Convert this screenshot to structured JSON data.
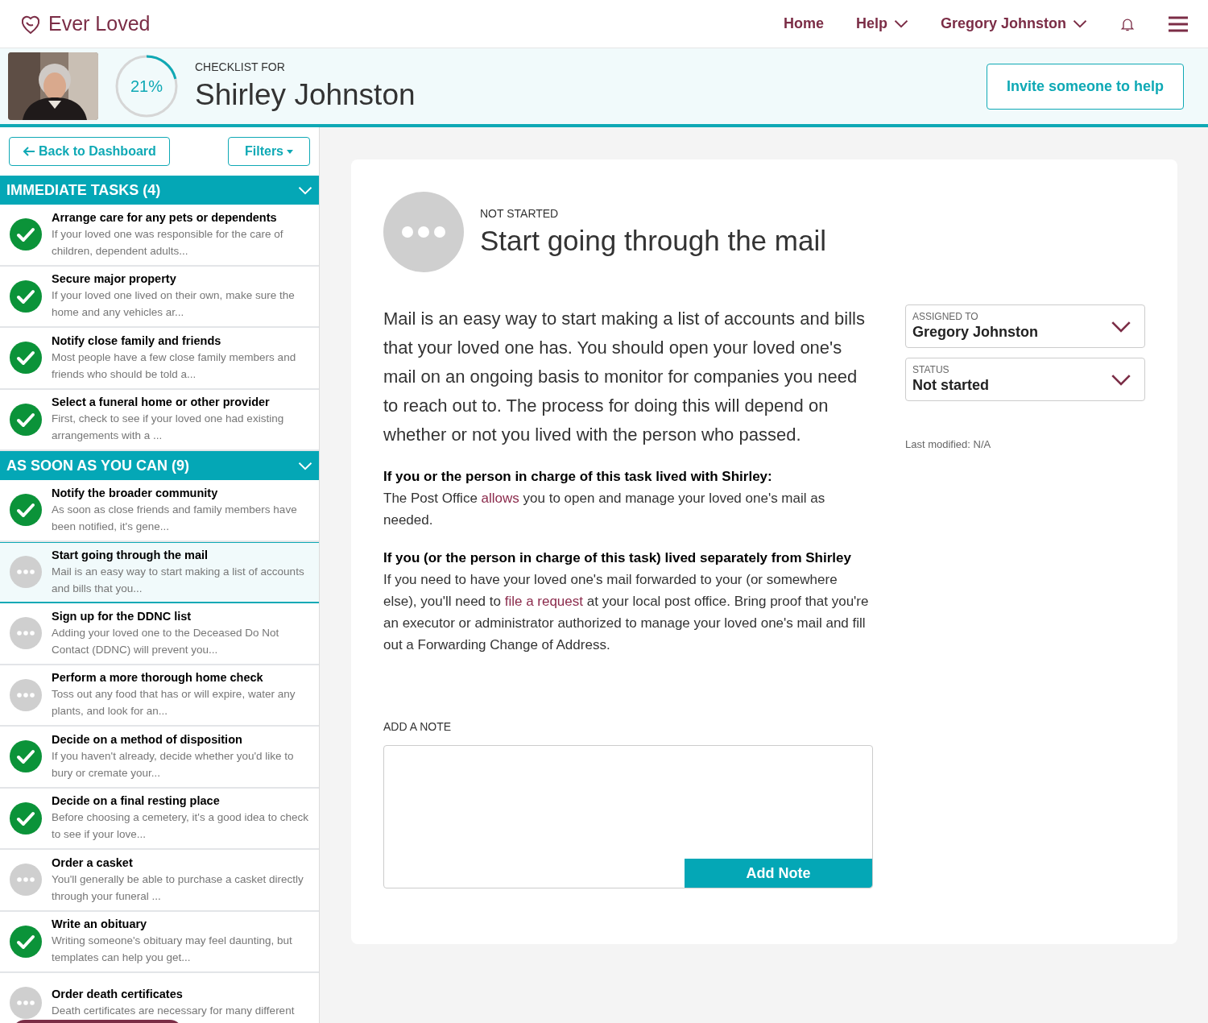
{
  "brand": {
    "name": "Ever Loved"
  },
  "nav": {
    "links": [
      {
        "label": "Home",
        "caret": false
      },
      {
        "label": "Help",
        "caret": true
      },
      {
        "label": "Gregory Johnston",
        "caret": true
      }
    ]
  },
  "banner": {
    "progress": {
      "level": 0.21,
      "reading": "21%"
    },
    "eyebrow": "CHECKLIST FOR",
    "name": "Shirley Johnston",
    "invite_button": "Invite someone to help"
  },
  "sidebar": {
    "back_button": "Back to Dashboard",
    "filters_button": "Filters",
    "sections": [
      {
        "title": "IMMEDIATE TASKS (4)",
        "expanded": true,
        "tasks": [
          {
            "title": "Arrange care for any pets or dependents",
            "summary": "If your loved one was responsible for the care of children, dependent adults...",
            "kind": "done",
            "selected": false
          },
          {
            "title": "Secure major property",
            "summary": "If your loved one lived on their own, make sure the home and any vehicles ar...",
            "kind": "done",
            "selected": false
          },
          {
            "title": "Notify close family and friends",
            "summary": "Most people have a few close family members and friends who should be told a...",
            "kind": "done",
            "selected": false
          },
          {
            "title": "Select a funeral home or other provider",
            "summary": "First, check to see if your loved one had existing arrangements with a ...",
            "kind": "done",
            "selected": false
          }
        ]
      },
      {
        "title": "AS SOON AS YOU CAN (9)",
        "expanded": true,
        "tasks": [
          {
            "title": "Notify the broader community",
            "summary": "As soon as close friends and family members have been notified, it's gene...",
            "kind": "done",
            "selected": false
          },
          {
            "title": "Start going through the mail",
            "summary": "Mail is an easy way to start making a list of accounts and bills that you...",
            "kind": "pending",
            "selected": true
          },
          {
            "title": "Sign up for the DDNC list",
            "summary": "Adding your loved one to the Deceased Do Not Contact (DDNC) will prevent you...",
            "kind": "pending",
            "selected": false
          },
          {
            "title": "Perform a more thorough home check",
            "summary": "Toss out any food that has or will expire, water any plants, and look for an...",
            "kind": "pending",
            "selected": false
          },
          {
            "title": "Decide on a method of disposition",
            "summary": "If you haven't already, decide whether you'd like to bury or cremate your...",
            "kind": "done",
            "selected": false
          },
          {
            "title": "Decide on a final resting place",
            "summary": "Before choosing a cemetery, it's a good idea to check to see if your love...",
            "kind": "done",
            "selected": false
          },
          {
            "title": "Order a casket",
            "summary": "You'll generally be able to purchase a casket directly through your funeral ...",
            "kind": "pending",
            "selected": false
          },
          {
            "title": "Write an obituary",
            "summary": "Writing someone's obituary may feel daunting, but templates can help you get...",
            "kind": "done",
            "selected": false
          },
          {
            "title": "Order death certificates",
            "summary": "Death certificates are necessary for many different",
            "kind": "pending",
            "selected": false
          }
        ]
      }
    ]
  },
  "task": {
    "status": "NOT STARTED",
    "kind": "pending",
    "title": "Start going through the mail",
    "intro": "Mail is an easy way to start making a list of accounts and bills that your loved one has. You should open your loved one's mail on an ongoing basis to monitor for companies you need to reach out to. The process for doing this will depend on whether or not you lived with the person who passed.",
    "blocks": [
      {
        "heading": "If you or the person in charge of this task lived with Shirley:",
        "before": "The Post Office ",
        "link": "allows",
        "after": " you to open and manage your loved one's mail as needed."
      },
      {
        "heading": "If you (or the person in charge of this task) lived separately from Shirley",
        "before": "If you need to have your loved one's mail forwarded to your (or somewhere else), you'll need to ",
        "link": "file a request",
        "after": " at your local post office. Bring proof that you're an executor or administrator authorized to manage your loved one's mail and fill out a Forwarding Change of Address."
      }
    ],
    "note_label": "ADD A NOTE",
    "note_button": "Add Note",
    "fields": [
      {
        "label": "ASSIGNED TO",
        "value": "Gregory Johnston"
      },
      {
        "label": "STATUS",
        "value": "Not started"
      }
    ],
    "last_modified": "Last modified: N/A"
  }
}
